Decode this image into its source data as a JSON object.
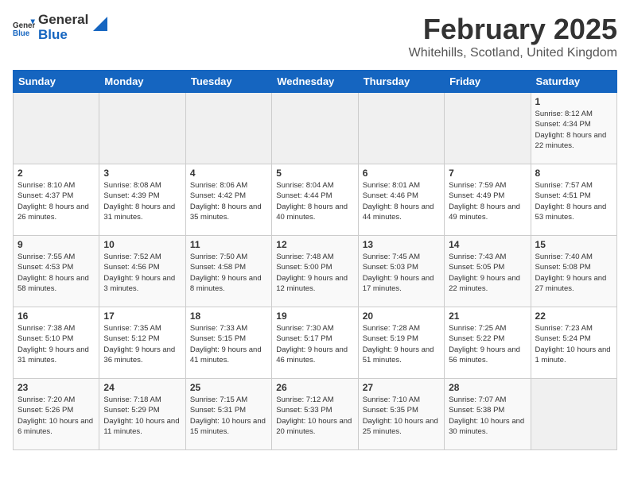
{
  "header": {
    "logo_general": "General",
    "logo_blue": "Blue",
    "month_title": "February 2025",
    "location": "Whitehills, Scotland, United Kingdom"
  },
  "days_of_week": [
    "Sunday",
    "Monday",
    "Tuesday",
    "Wednesday",
    "Thursday",
    "Friday",
    "Saturday"
  ],
  "weeks": [
    [
      {
        "day": "",
        "sunrise": "",
        "sunset": "",
        "daylight": ""
      },
      {
        "day": "",
        "sunrise": "",
        "sunset": "",
        "daylight": ""
      },
      {
        "day": "",
        "sunrise": "",
        "sunset": "",
        "daylight": ""
      },
      {
        "day": "",
        "sunrise": "",
        "sunset": "",
        "daylight": ""
      },
      {
        "day": "",
        "sunrise": "",
        "sunset": "",
        "daylight": ""
      },
      {
        "day": "",
        "sunrise": "",
        "sunset": "",
        "daylight": ""
      },
      {
        "day": "1",
        "sunrise": "Sunrise: 8:12 AM",
        "sunset": "Sunset: 4:34 PM",
        "daylight": "Daylight: 8 hours and 22 minutes."
      }
    ],
    [
      {
        "day": "2",
        "sunrise": "Sunrise: 8:10 AM",
        "sunset": "Sunset: 4:37 PM",
        "daylight": "Daylight: 8 hours and 26 minutes."
      },
      {
        "day": "3",
        "sunrise": "Sunrise: 8:08 AM",
        "sunset": "Sunset: 4:39 PM",
        "daylight": "Daylight: 8 hours and 31 minutes."
      },
      {
        "day": "4",
        "sunrise": "Sunrise: 8:06 AM",
        "sunset": "Sunset: 4:42 PM",
        "daylight": "Daylight: 8 hours and 35 minutes."
      },
      {
        "day": "5",
        "sunrise": "Sunrise: 8:04 AM",
        "sunset": "Sunset: 4:44 PM",
        "daylight": "Daylight: 8 hours and 40 minutes."
      },
      {
        "day": "6",
        "sunrise": "Sunrise: 8:01 AM",
        "sunset": "Sunset: 4:46 PM",
        "daylight": "Daylight: 8 hours and 44 minutes."
      },
      {
        "day": "7",
        "sunrise": "Sunrise: 7:59 AM",
        "sunset": "Sunset: 4:49 PM",
        "daylight": "Daylight: 8 hours and 49 minutes."
      },
      {
        "day": "8",
        "sunrise": "Sunrise: 7:57 AM",
        "sunset": "Sunset: 4:51 PM",
        "daylight": "Daylight: 8 hours and 53 minutes."
      }
    ],
    [
      {
        "day": "9",
        "sunrise": "Sunrise: 7:55 AM",
        "sunset": "Sunset: 4:53 PM",
        "daylight": "Daylight: 8 hours and 58 minutes."
      },
      {
        "day": "10",
        "sunrise": "Sunrise: 7:52 AM",
        "sunset": "Sunset: 4:56 PM",
        "daylight": "Daylight: 9 hours and 3 minutes."
      },
      {
        "day": "11",
        "sunrise": "Sunrise: 7:50 AM",
        "sunset": "Sunset: 4:58 PM",
        "daylight": "Daylight: 9 hours and 8 minutes."
      },
      {
        "day": "12",
        "sunrise": "Sunrise: 7:48 AM",
        "sunset": "Sunset: 5:00 PM",
        "daylight": "Daylight: 9 hours and 12 minutes."
      },
      {
        "day": "13",
        "sunrise": "Sunrise: 7:45 AM",
        "sunset": "Sunset: 5:03 PM",
        "daylight": "Daylight: 9 hours and 17 minutes."
      },
      {
        "day": "14",
        "sunrise": "Sunrise: 7:43 AM",
        "sunset": "Sunset: 5:05 PM",
        "daylight": "Daylight: 9 hours and 22 minutes."
      },
      {
        "day": "15",
        "sunrise": "Sunrise: 7:40 AM",
        "sunset": "Sunset: 5:08 PM",
        "daylight": "Daylight: 9 hours and 27 minutes."
      }
    ],
    [
      {
        "day": "16",
        "sunrise": "Sunrise: 7:38 AM",
        "sunset": "Sunset: 5:10 PM",
        "daylight": "Daylight: 9 hours and 31 minutes."
      },
      {
        "day": "17",
        "sunrise": "Sunrise: 7:35 AM",
        "sunset": "Sunset: 5:12 PM",
        "daylight": "Daylight: 9 hours and 36 minutes."
      },
      {
        "day": "18",
        "sunrise": "Sunrise: 7:33 AM",
        "sunset": "Sunset: 5:15 PM",
        "daylight": "Daylight: 9 hours and 41 minutes."
      },
      {
        "day": "19",
        "sunrise": "Sunrise: 7:30 AM",
        "sunset": "Sunset: 5:17 PM",
        "daylight": "Daylight: 9 hours and 46 minutes."
      },
      {
        "day": "20",
        "sunrise": "Sunrise: 7:28 AM",
        "sunset": "Sunset: 5:19 PM",
        "daylight": "Daylight: 9 hours and 51 minutes."
      },
      {
        "day": "21",
        "sunrise": "Sunrise: 7:25 AM",
        "sunset": "Sunset: 5:22 PM",
        "daylight": "Daylight: 9 hours and 56 minutes."
      },
      {
        "day": "22",
        "sunrise": "Sunrise: 7:23 AM",
        "sunset": "Sunset: 5:24 PM",
        "daylight": "Daylight: 10 hours and 1 minute."
      }
    ],
    [
      {
        "day": "23",
        "sunrise": "Sunrise: 7:20 AM",
        "sunset": "Sunset: 5:26 PM",
        "daylight": "Daylight: 10 hours and 6 minutes."
      },
      {
        "day": "24",
        "sunrise": "Sunrise: 7:18 AM",
        "sunset": "Sunset: 5:29 PM",
        "daylight": "Daylight: 10 hours and 11 minutes."
      },
      {
        "day": "25",
        "sunrise": "Sunrise: 7:15 AM",
        "sunset": "Sunset: 5:31 PM",
        "daylight": "Daylight: 10 hours and 15 minutes."
      },
      {
        "day": "26",
        "sunrise": "Sunrise: 7:12 AM",
        "sunset": "Sunset: 5:33 PM",
        "daylight": "Daylight: 10 hours and 20 minutes."
      },
      {
        "day": "27",
        "sunrise": "Sunrise: 7:10 AM",
        "sunset": "Sunset: 5:35 PM",
        "daylight": "Daylight: 10 hours and 25 minutes."
      },
      {
        "day": "28",
        "sunrise": "Sunrise: 7:07 AM",
        "sunset": "Sunset: 5:38 PM",
        "daylight": "Daylight: 10 hours and 30 minutes."
      },
      {
        "day": "",
        "sunrise": "",
        "sunset": "",
        "daylight": ""
      }
    ]
  ]
}
